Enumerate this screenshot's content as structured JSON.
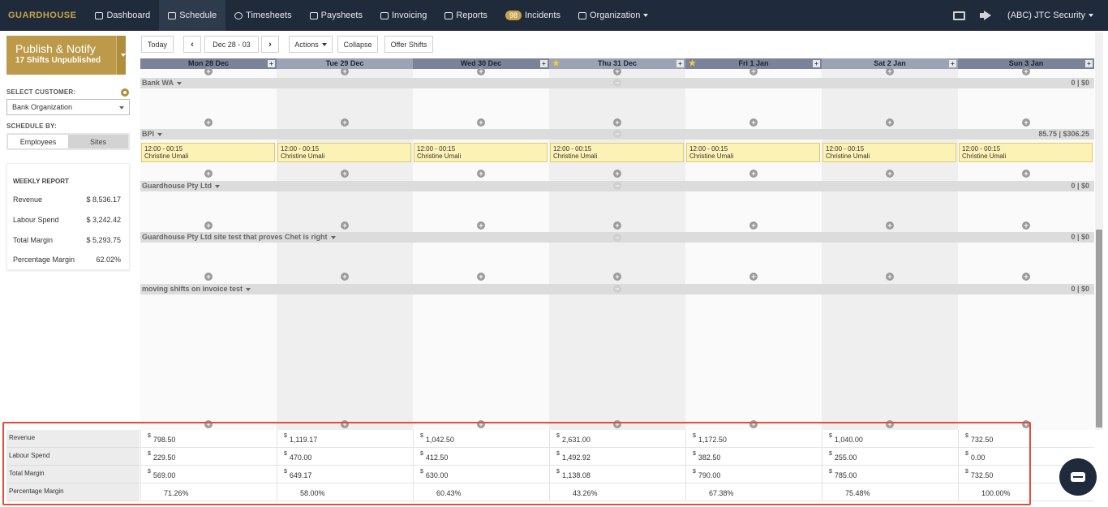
{
  "nav": {
    "brand": "GUARDHOUSE",
    "items": [
      {
        "label": "Dashboard",
        "icon": "dashboard-icon"
      },
      {
        "label": "Schedule",
        "icon": "calendar-icon"
      },
      {
        "label": "Timesheets",
        "icon": "clock-icon"
      },
      {
        "label": "Paysheets",
        "icon": "money-icon"
      },
      {
        "label": "Invoicing",
        "icon": "invoice-icon"
      },
      {
        "label": "Reports",
        "icon": "table-icon"
      },
      {
        "label": "Incidents",
        "icon": "incidents-icon",
        "badge": "98"
      },
      {
        "label": "Organization",
        "icon": "users-icon"
      }
    ],
    "org": "(ABC) JTC Security"
  },
  "publish": {
    "title": "Publish & Notify",
    "subtitle": "17 Shifts Unpublished"
  },
  "sidebar": {
    "select_customer_label": "SELECT CUSTOMER:",
    "customer": "Bank Organization",
    "schedule_by_label": "SCHEDULE BY:",
    "employees": "Employees",
    "sites": "Sites"
  },
  "weekly_report": {
    "title": "WEEKLY REPORT",
    "rows": [
      {
        "label": "Revenue",
        "value": "$ 8,536.17"
      },
      {
        "label": "Labour Spend",
        "value": "$ 3,242.42"
      },
      {
        "label": "Total Margin",
        "value": "$ 5,293.75"
      },
      {
        "label": "Percentage Margin",
        "value": "62.02%"
      }
    ]
  },
  "toolbar": {
    "today": "Today",
    "range": "Dec 28 - 03",
    "actions": "Actions",
    "collapse": "Collapse",
    "offer": "Offer Shifts"
  },
  "days": [
    {
      "label": "Mon 28 Dec"
    },
    {
      "label": "Tue 29 Dec"
    },
    {
      "label": "Wed 30 Dec"
    },
    {
      "label": "Thu 31 Dec"
    },
    {
      "label": "Fri 1 Jan"
    },
    {
      "label": "Sat 2 Jan"
    },
    {
      "label": "Sun 3 Jan"
    }
  ],
  "sites": [
    {
      "name": "Bank WA",
      "total": "0 | $0"
    },
    {
      "name": "BPI",
      "total": "85.75 | $306.25"
    },
    {
      "name": "Guardhouse Pty Ltd",
      "total": "0 | $0"
    },
    {
      "name": "Guardhouse Pty Ltd site test that proves Chet is right",
      "total": "0 | $0"
    },
    {
      "name": "moving shifts on invoice test",
      "total": "0 | $0"
    }
  ],
  "shift": {
    "time": "12:00 - 00:15",
    "employee": "Christine Umali"
  },
  "totals": {
    "labels": [
      "Revenue",
      "Labour Spend",
      "Total Margin",
      "Percentage Margin"
    ],
    "currency": "$",
    "revenue": [
      "798.50",
      "1,119.17",
      "1,042.50",
      "2,631.00",
      "1,172.50",
      "1,040.00",
      "732.50"
    ],
    "labour": [
      "229.50",
      "470.00",
      "412.50",
      "1,492.92",
      "382.50",
      "255.00",
      "0.00"
    ],
    "margin": [
      "569.00",
      "649.17",
      "630.00",
      "1,138.08",
      "790.00",
      "785.00",
      "732.50"
    ],
    "pct": [
      "71.26%",
      "58.00%",
      "60.43%",
      "43.26%",
      "67.38%",
      "75.48%",
      "100.00%"
    ]
  }
}
